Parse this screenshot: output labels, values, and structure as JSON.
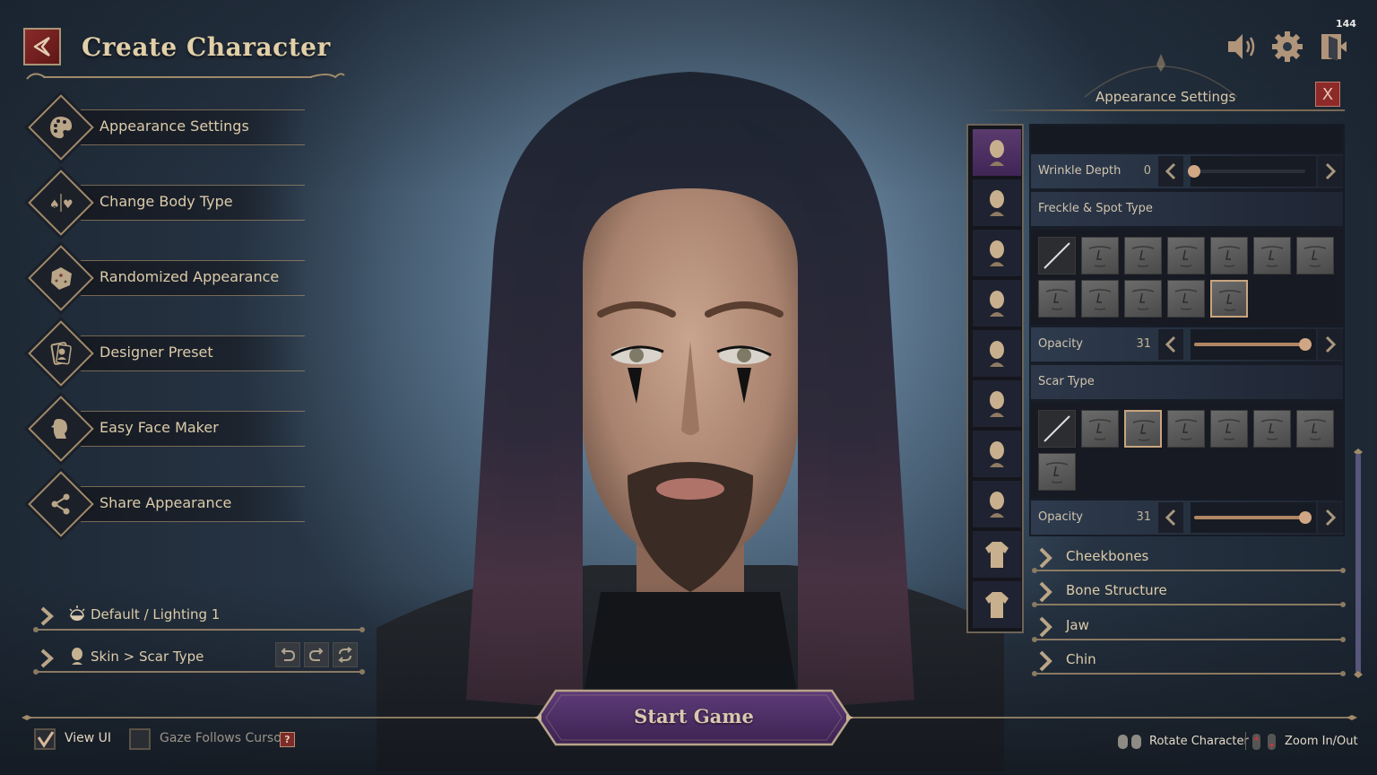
{
  "header": {
    "title": "Create Character",
    "back_icon": "back-arrow-icon",
    "fps": "144"
  },
  "top_icons": [
    {
      "name": "sound-icon"
    },
    {
      "name": "gear-icon"
    },
    {
      "name": "exit-door-icon"
    }
  ],
  "menu": {
    "items": [
      {
        "label": "Appearance Settings",
        "icon": "palette-icon"
      },
      {
        "label": "Change Body Type",
        "icon": "spade-heart-icon"
      },
      {
        "label": "Randomized Appearance",
        "icon": "dice-icon"
      },
      {
        "label": "Designer Preset",
        "icon": "portrait-card-icon"
      },
      {
        "label": "Easy Face Maker",
        "icon": "face-profile-icon"
      },
      {
        "label": "Share Appearance",
        "icon": "share-icon"
      }
    ]
  },
  "breadcrumbs": {
    "lighting": "Default / Lighting 1",
    "path": "Skin > Scar Type",
    "undo": "undo-icon",
    "redo": "redo-icon",
    "reset": "reset-icon"
  },
  "bottom": {
    "view_ui_label": "View UI",
    "view_ui_checked": true,
    "gaze_label": "Gaze Follows Cursor",
    "gaze_checked": false,
    "help_label": "?",
    "start_game": "Start Game",
    "rotate_hint": "Rotate Character",
    "zoom_hint": "Zoom In/Out"
  },
  "panel": {
    "title": "Appearance Settings",
    "close_label": "X",
    "categories": [
      {
        "name": "face-shape",
        "active": true
      },
      {
        "name": "eyebrows",
        "active": false
      },
      {
        "name": "eyes",
        "active": false
      },
      {
        "name": "nose",
        "active": false
      },
      {
        "name": "mouth",
        "active": false
      },
      {
        "name": "ears",
        "active": false
      },
      {
        "name": "face-paint",
        "active": false
      },
      {
        "name": "hair",
        "active": false
      },
      {
        "name": "body",
        "active": false
      },
      {
        "name": "outfit",
        "active": false
      }
    ],
    "wrinkle": {
      "label": "Wrinkle Depth",
      "value": "0",
      "percent": 0
    },
    "freckle": {
      "label": "Freckle & Spot Type",
      "count": 12,
      "selected_index": 11
    },
    "freckle_opacity": {
      "label": "Opacity",
      "value": "31",
      "percent": 100
    },
    "scar": {
      "label": "Scar Type",
      "count": 8,
      "selected_index": 2
    },
    "scar_opacity": {
      "label": "Opacity",
      "value": "31",
      "percent": 100
    },
    "sections": [
      {
        "label": "Cheekbones"
      },
      {
        "label": "Bone Structure"
      },
      {
        "label": "Jaw"
      },
      {
        "label": "Chin"
      }
    ]
  },
  "colors": {
    "gold": "#c8a57e",
    "accent_purple": "#4c2f63",
    "close_red": "#8c2a2a"
  }
}
